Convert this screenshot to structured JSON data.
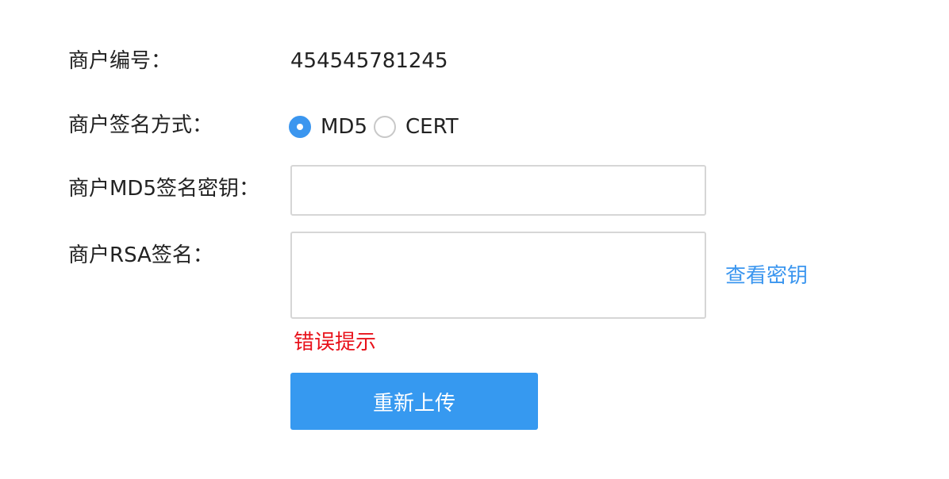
{
  "form": {
    "merchant_id": {
      "label": "商户编号：",
      "value": "454545781245"
    },
    "sign_method": {
      "label": "商户签名方式：",
      "options": [
        {
          "label": "MD5",
          "checked": true
        },
        {
          "label": "CERT",
          "checked": false
        }
      ]
    },
    "md5_key": {
      "label": "商户MD5签名密钥：",
      "value": "",
      "placeholder": ""
    },
    "rsa_sign": {
      "label": "商户RSA签名：",
      "value": "",
      "placeholder": "",
      "view_key_link": "查看密钥",
      "error_text": "错误提示"
    },
    "reupload_button": "重新上传"
  },
  "colors": {
    "accent": "#3b96ef",
    "button": "#3699f0",
    "error": "#e8121b",
    "text": "#222222",
    "border": "#d6d6d6"
  }
}
